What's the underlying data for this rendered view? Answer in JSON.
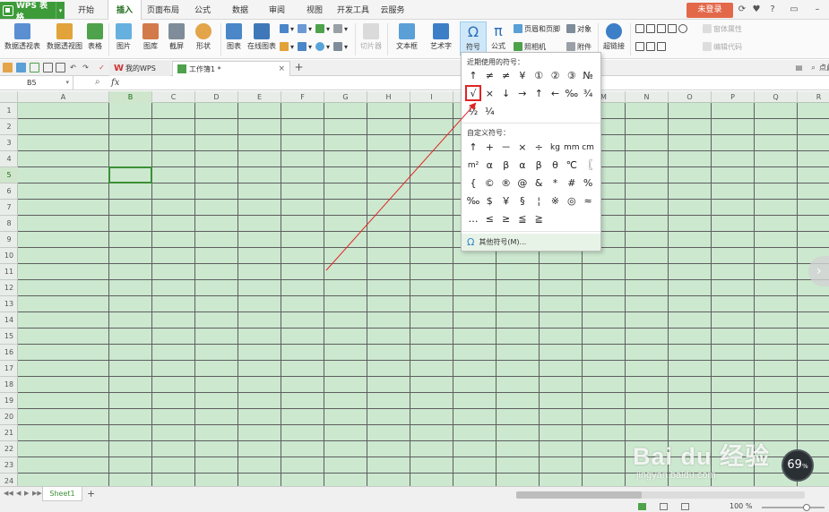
{
  "titlebar": {
    "app_name": "WPS 表格",
    "tabs": [
      "开始",
      "插入",
      "页面布局",
      "公式",
      "数据",
      "审阅",
      "视图",
      "开发工具",
      "云服务"
    ],
    "active_tab": "插入",
    "login_label": "未登录",
    "question_label": "?"
  },
  "ribbon": {
    "pivot_table": "数据透视表",
    "pivot_chart": "数据透视图",
    "table": "表格",
    "picture": "图片",
    "gallery": "图库",
    "screenshot": "截屏",
    "shapes": "形状",
    "chart": "图表",
    "online_chart": "在线图表",
    "slicer": "切片器",
    "textbox": "文本框",
    "wordart": "艺术字",
    "symbol": "符号",
    "formula": "公式",
    "header_footer": "页眉和页脚",
    "object": "对象",
    "camera": "照相机",
    "attachment": "附件",
    "hyperlink": "超链接",
    "form_props": "窗体属性",
    "edit_code": "编辑代码"
  },
  "docbar": {
    "wps_tab": "我的WPS",
    "book_tab": "工作簿1 *",
    "search_placeholder": "点此查"
  },
  "formula_bar": {
    "cell_ref": "B5",
    "fx": "fx"
  },
  "sheet": {
    "columns": [
      "A",
      "B",
      "C",
      "D",
      "E",
      "F",
      "G",
      "H",
      "I",
      "J",
      "K",
      "L",
      "M",
      "N",
      "O",
      "P",
      "Q",
      "R"
    ],
    "rows": [
      "1",
      "2",
      "3",
      "4",
      "5",
      "6",
      "7",
      "8",
      "9",
      "10",
      "11",
      "12",
      "13",
      "14",
      "15",
      "16",
      "17",
      "18",
      "19",
      "20",
      "21",
      "22",
      "23",
      "24"
    ],
    "selected_column": "B",
    "selected_row": "5",
    "sheet_tab": "Sheet1"
  },
  "status": {
    "zoom": "100 %"
  },
  "symbol_menu": {
    "recent_header": "近期使用的符号：",
    "recent_row1": [
      "↑",
      "≠",
      "≠",
      "¥",
      "①",
      "②",
      "③",
      "№"
    ],
    "recent_row2": [
      "√",
      "×",
      "↓",
      "→",
      "↑",
      "←",
      "‰",
      "¾"
    ],
    "recent_row3": [
      "½",
      "¼"
    ],
    "custom_header": "自定义符号：",
    "custom_row1": [
      "↑",
      "+",
      "－",
      "×",
      "÷",
      "kg",
      "mm",
      "cm"
    ],
    "custom_row2": [
      "m²",
      "α",
      "β",
      "α",
      "β",
      "θ",
      "℃",
      "〖"
    ],
    "custom_row3": [
      "{",
      "©",
      "®",
      "@",
      "&",
      "*",
      "#",
      "%"
    ],
    "custom_row4": [
      "‰",
      "$",
      "￥",
      "§",
      "¦",
      "※",
      "◎",
      "≈"
    ],
    "custom_row5": [
      "…",
      "≤",
      "≥",
      "≦",
      "≧"
    ],
    "more_label": "其他符号(M)..."
  },
  "overlay": {
    "perf_value": "69",
    "perf_unit": "%",
    "watermark_main": "Bai du 经验",
    "watermark_sub": "jingyan.baidu.com"
  },
  "colors": {
    "accent_green": "#3d9b3a",
    "grid_bg": "#cce8cf",
    "login_red": "#e3684a",
    "highlight_red": "#e02424"
  }
}
